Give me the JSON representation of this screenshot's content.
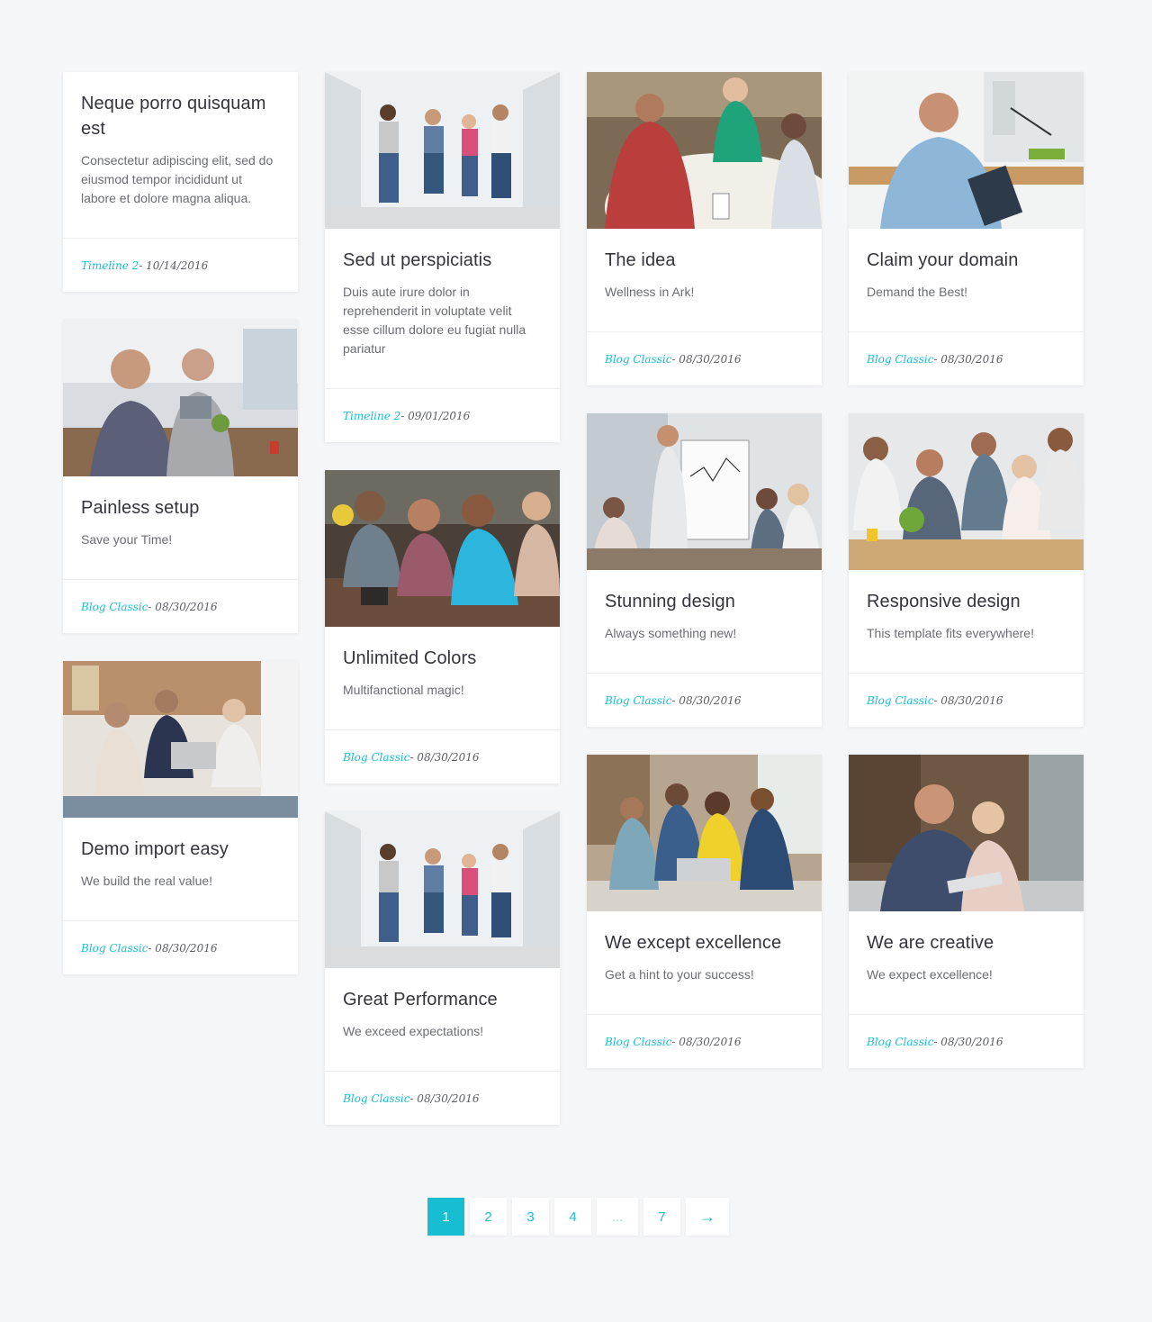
{
  "cards": [
    {
      "title": "Neque porro quisquam est",
      "excerpt": "Consectetur adipiscing elit, sed do eiusmod tempor incididunt ut labore et dolore magna aliqua.",
      "category": "Timeline 2",
      "date": " - 10/14/2016"
    },
    {
      "title": "Painless setup",
      "excerpt": "Save your Time!",
      "category": "Blog Classic",
      "date": " - 08/30/2016",
      "image": "office-man-smiling-tablet"
    },
    {
      "title": "Demo import easy",
      "excerpt": "We build the real value!",
      "category": "Blog Classic",
      "date": " - 08/30/2016",
      "image": "business-meeting-laptop"
    },
    {
      "title": "Sed ut perspiciatis",
      "excerpt": "Duis aute irure dolor in reprehenderit in voluptate velit esse cillum dolore eu fugiat nulla pariatur",
      "category": "Timeline 2",
      "date": " - 09/01/2016",
      "image": "people-jumping-hallway"
    },
    {
      "title": "Unlimited Colors",
      "excerpt": "Multifanctional magic!",
      "category": "Blog Classic",
      "date": " - 08/30/2016",
      "image": "friends-looking-phones"
    },
    {
      "title": "Great Performance",
      "excerpt": "We exceed expectations!",
      "category": "Blog Classic",
      "date": " - 08/30/2016",
      "image": "people-jumping-hallway"
    },
    {
      "title": "The idea",
      "excerpt": "Wellness in Ark!",
      "category": "Blog Classic",
      "date": " - 08/30/2016",
      "image": "team-drawing-whiteboard"
    },
    {
      "title": "Stunning design",
      "excerpt": "Always something new!",
      "category": "Blog Classic",
      "date": " - 08/30/2016",
      "image": "flipchart-presentation"
    },
    {
      "title": "We except excellence",
      "excerpt": "Get a hint to your success!",
      "category": "Blog Classic",
      "date": " - 08/30/2016",
      "image": "team-around-laptop"
    },
    {
      "title": "Claim your domain",
      "excerpt": "Demand the Best!",
      "category": "Blog Classic",
      "date": " - 08/30/2016",
      "image": "man-phone-clipboard"
    },
    {
      "title": "Responsive design",
      "excerpt": "This template fits everywhere!",
      "category": "Blog Classic",
      "date": " - 08/30/2016",
      "image": "group-looking-laptop"
    },
    {
      "title": "We are creative",
      "excerpt": "We expect excellence!",
      "category": "Blog Classic",
      "date": " - 08/30/2016",
      "image": "couple-with-tablet"
    }
  ],
  "pagination": {
    "pages": [
      "1",
      "2",
      "3",
      "4",
      "...",
      "7"
    ],
    "next": "→",
    "active": "1"
  },
  "colors": {
    "accent": "#17bed2",
    "background": "#f5f6f8"
  }
}
